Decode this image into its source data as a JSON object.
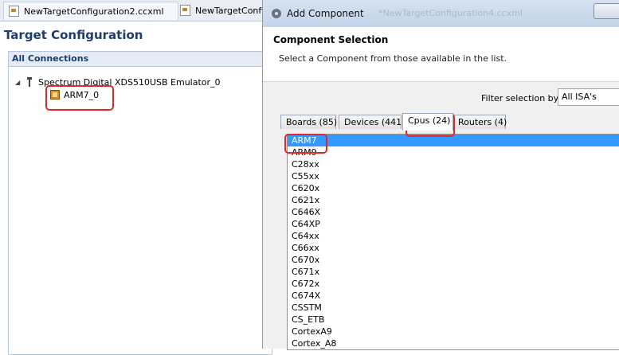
{
  "editor_tabs": [
    {
      "label": "NewTargetConfiguration2.ccxml"
    },
    {
      "label": "NewTargetConfig"
    }
  ],
  "target_config": {
    "title": "Target Configuration",
    "connections_header": "All Connections",
    "emulator_label": "Spectrum Digital XDS510USB Emulator_0",
    "cpu_label": "ARM7_0"
  },
  "dialog": {
    "title": "Add Component",
    "ghost_title": "*NewTargetConfiguration4.ccxml",
    "heading": "Component Selection",
    "subtitle": "Select a Component from those available in the list.",
    "filter_label": "Filter selection by",
    "filter_value": "All ISA's",
    "tabs": [
      {
        "label": "Boards (85)"
      },
      {
        "label": "Devices (441)"
      },
      {
        "label": "Cpus (24)"
      },
      {
        "label": "Routers (4)"
      }
    ],
    "active_tab": "Cpus (24)",
    "list": [
      "ARM7",
      "ARM9",
      "C28xx",
      "C55xx",
      "C620x",
      "C621x",
      "C646X",
      "C64XP",
      "C64xx",
      "C66xx",
      "C670x",
      "C671x",
      "C672x",
      "C674X",
      "CSSTM",
      "CS_ETB",
      "CortexA9",
      "Cortex_A8"
    ],
    "selected_item": "ARM7"
  },
  "highlight_color": "#e12828",
  "selection_color": "#3399ff"
}
